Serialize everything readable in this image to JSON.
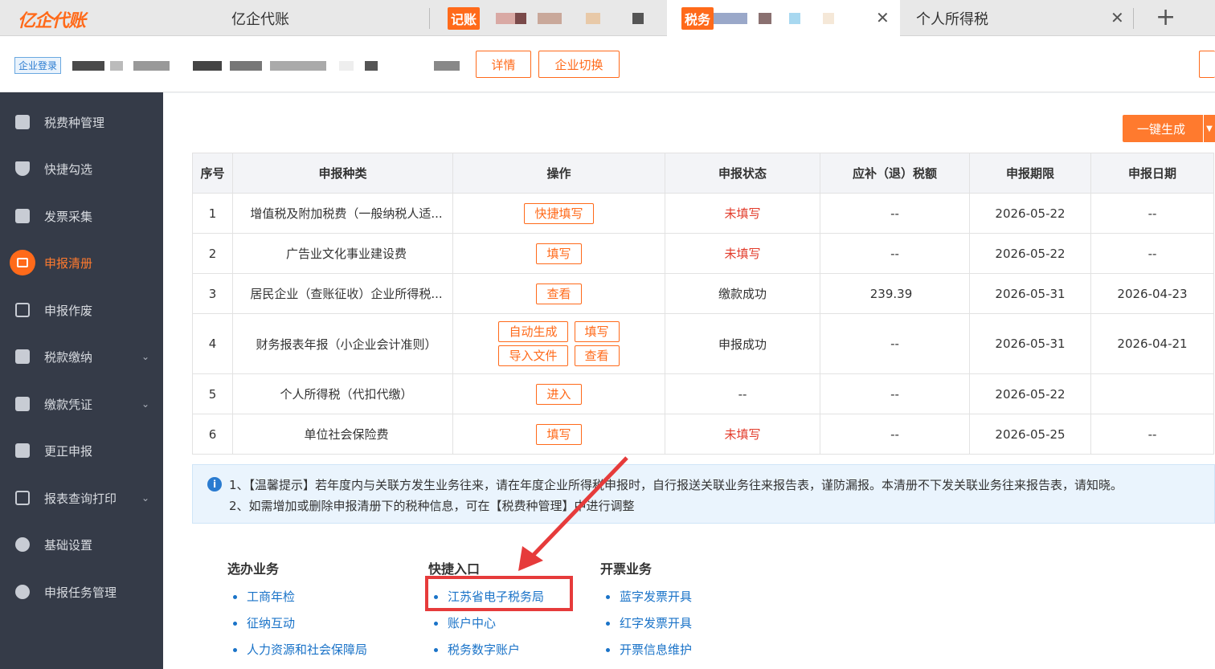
{
  "app": {
    "logo": "亿企代账"
  },
  "tabs": [
    {
      "label": "亿企代账"
    },
    {
      "badge": "记账"
    },
    {
      "badge": "税务"
    },
    {
      "label": "个人所得税"
    }
  ],
  "company": {
    "login_tag": "企业登录",
    "detail_button": "详情",
    "switch_button": "企业切换"
  },
  "sidebar": {
    "items": [
      {
        "label": "税费种管理",
        "icon": "hand-coin-icon"
      },
      {
        "label": "快捷勾选",
        "icon": "shield-icon"
      },
      {
        "label": "发票采集",
        "icon": "invoice-icon"
      },
      {
        "label": "申报清册",
        "icon": "list-icon",
        "active": true
      },
      {
        "label": "申报作废",
        "icon": "void-doc-icon"
      },
      {
        "label": "税款缴纳",
        "icon": "yen-icon",
        "chevron": "⌄"
      },
      {
        "label": "缴款凭证",
        "icon": "receipt-icon",
        "chevron": "⌄"
      },
      {
        "label": "更正申报",
        "icon": "edit-icon"
      },
      {
        "label": "报表查询打印",
        "icon": "search-doc-icon",
        "chevron": "⌄"
      },
      {
        "label": "基础设置",
        "icon": "gear-icon"
      },
      {
        "label": "申报任务管理",
        "icon": "clock-icon"
      }
    ]
  },
  "toolbar": {
    "generate_button": "一键生成",
    "generate_drop": "▼"
  },
  "table": {
    "headers": [
      "序号",
      "申报种类",
      "操作",
      "申报状态",
      "应补（退）税额",
      "申报期限",
      "申报日期"
    ],
    "rows": [
      {
        "no": "1",
        "type": "增值税及附加税费（一般纳税人适...",
        "ops": [
          "快捷填写"
        ],
        "status": "未填写",
        "status_red": true,
        "amount": "--",
        "deadline": "2026-05-22",
        "date": "--"
      },
      {
        "no": "2",
        "type": "广告业文化事业建设费",
        "ops": [
          "填写"
        ],
        "status": "未填写",
        "status_red": true,
        "amount": "--",
        "deadline": "2026-05-22",
        "date": "--"
      },
      {
        "no": "3",
        "type": "居民企业（查账征收）企业所得税...",
        "ops": [
          "查看"
        ],
        "status": "缴款成功",
        "status_red": false,
        "amount": "239.39",
        "deadline": "2026-05-31",
        "date": "2026-04-23"
      },
      {
        "no": "4",
        "type": "财务报表年报（小企业会计准则）",
        "ops": [
          "自动生成",
          "填写",
          "导入文件",
          "查看"
        ],
        "status": "申报成功",
        "status_red": false,
        "amount": "--",
        "deadline": "2026-05-31",
        "date": "2026-04-21"
      },
      {
        "no": "5",
        "type": "个人所得税（代扣代缴）",
        "ops": [
          "进入"
        ],
        "status": "--",
        "status_red": false,
        "amount": "--",
        "deadline": "2026-05-22",
        "date": ""
      },
      {
        "no": "6",
        "type": "单位社会保险费",
        "ops": [
          "填写"
        ],
        "status": "未填写",
        "status_red": true,
        "amount": "--",
        "deadline": "2026-05-25",
        "date": "--"
      }
    ]
  },
  "tips": {
    "line1": "1、【温馨提示】若年度内与关联方发生业务往来，请在年度企业所得税申报时，自行报送关联业务往来报告表，谨防漏报。本清册不下发关联业务往来报告表，请知晓。",
    "line2": "2、如需增加或删除申报清册下的税种信息，可在【税费种管理】中进行调整"
  },
  "quick": {
    "columns": [
      {
        "title": "选办业务",
        "items": [
          "工商年检",
          "征纳互动",
          "人力资源和社会保障局"
        ]
      },
      {
        "title": "快捷入口",
        "items": [
          "江苏省电子税务局",
          "账户中心",
          "税务数字账户"
        ]
      },
      {
        "title": "开票业务",
        "items": [
          "蓝字发票开具",
          "红字发票开具",
          "开票信息维护"
        ]
      }
    ]
  },
  "colors": {
    "accent": "#ff6a1a",
    "sidebar": "#353b48",
    "link": "#1a73c8",
    "warn": "#e23b2a",
    "annotation": "#e63b3b"
  }
}
